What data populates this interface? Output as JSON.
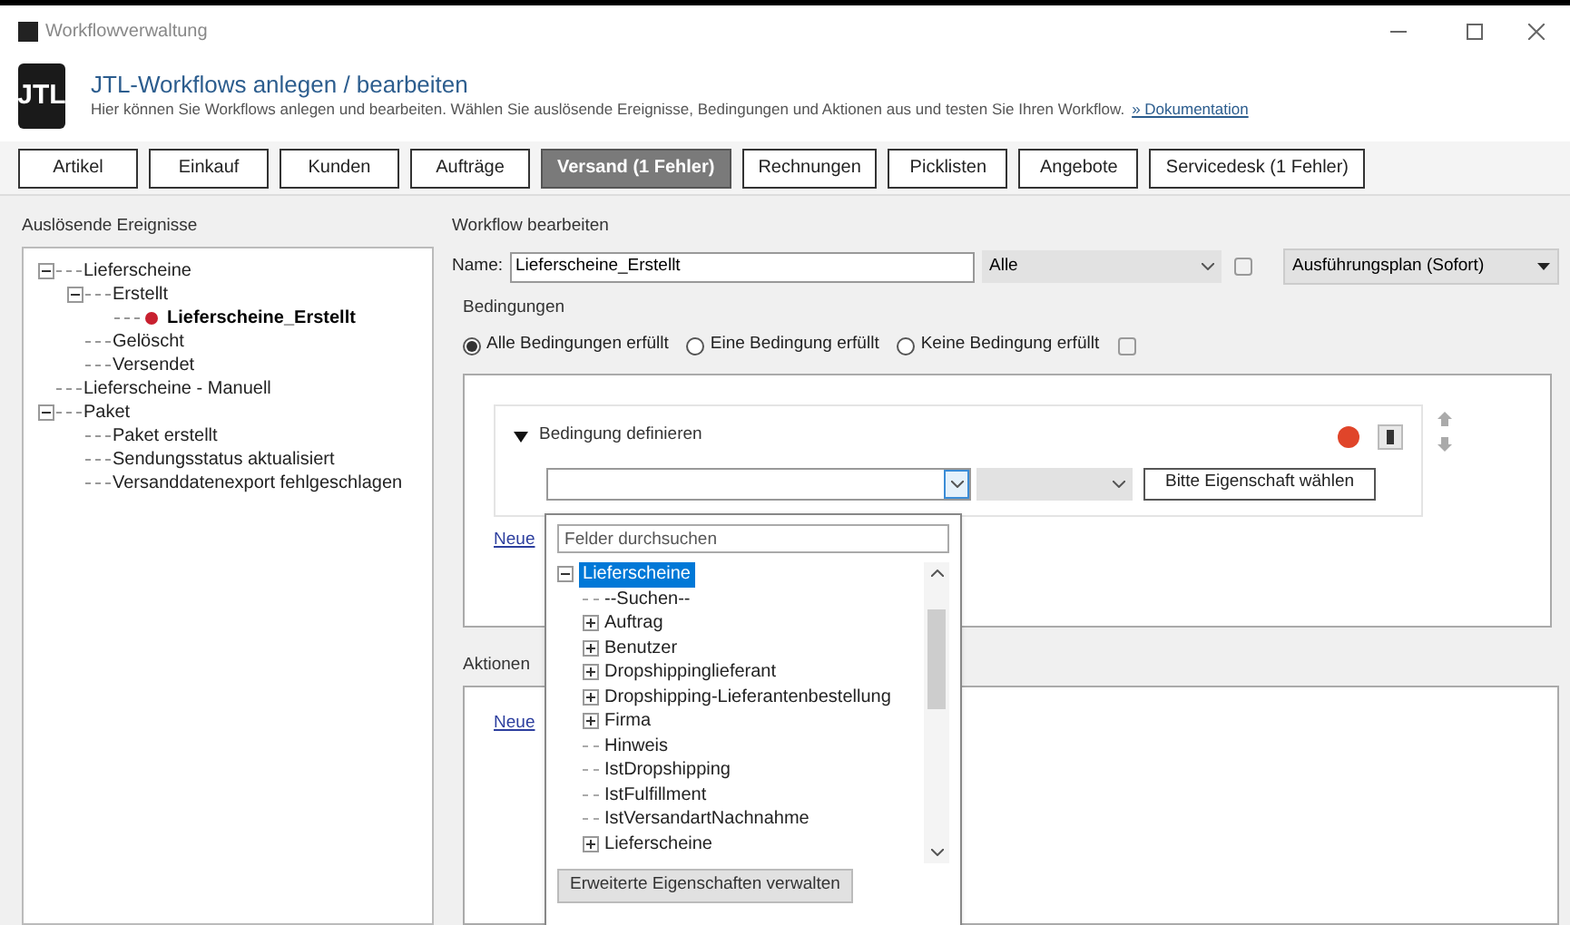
{
  "window": {
    "title": "Workflowverwaltung"
  },
  "header": {
    "logo": "JTL",
    "title": "JTL-Workflows anlegen / bearbeiten",
    "subtitle": "Hier können Sie Workflows anlegen und bearbeiten. Wählen Sie auslösende Ereignisse, Bedingungen und Aktionen aus und testen Sie Ihren Workflow.",
    "link": "» Dokumentation"
  },
  "tabs": [
    {
      "label": "Artikel",
      "selected": false
    },
    {
      "label": "Einkauf",
      "selected": false
    },
    {
      "label": "Kunden",
      "selected": false
    },
    {
      "label": "Aufträge",
      "selected": false
    },
    {
      "label": "Versand (1 Fehler)",
      "selected": true
    },
    {
      "label": "Rechnungen",
      "selected": false
    },
    {
      "label": "Picklisten",
      "selected": false
    },
    {
      "label": "Angebote",
      "selected": false
    },
    {
      "label": "Servicedesk (1 Fehler)",
      "selected": false
    }
  ],
  "events": {
    "title": "Auslösende Ereignisse",
    "tree": [
      {
        "label": "Lieferscheine",
        "kind": "event",
        "expanded": true,
        "children": [
          {
            "label": "Erstellt",
            "kind": "event",
            "expanded": true,
            "children": [
              {
                "label": "Lieferscheine_Erstellt",
                "kind": "workflow"
              }
            ]
          },
          {
            "label": "Gelöscht",
            "kind": "event"
          },
          {
            "label": "Versendet",
            "kind": "event"
          }
        ]
      },
      {
        "label": "Lieferscheine - Manuell",
        "kind": "event"
      },
      {
        "label": "Paket",
        "kind": "event",
        "expanded": true,
        "children": [
          {
            "label": "Paket erstellt",
            "kind": "event"
          },
          {
            "label": "Sendungsstatus aktualisiert",
            "kind": "event"
          },
          {
            "label": "Versanddatenexport fehlgeschlagen",
            "kind": "event"
          }
        ]
      }
    ]
  },
  "editor": {
    "title": "Workflow bearbeiten",
    "name_label": "Name:",
    "name_value": "Lieferscheine_Erstellt",
    "scope": "Alle",
    "schedule": "Ausführungsplan (Sofort)",
    "conditions": {
      "title": "Bedingungen",
      "modes": [
        {
          "label": "Alle Bedingungen erfüllt",
          "selected": true
        },
        {
          "label": "Eine Bedingung erfüllt",
          "selected": false
        },
        {
          "label": "Keine Bedingung erfüllt",
          "selected": false
        }
      ],
      "condition": {
        "title": "Bedingung definieren",
        "expanded": true,
        "error": true,
        "property_button": "Bitte Eigenschaft wählen"
      },
      "new_link": "Neue"
    },
    "actions": {
      "title": "Aktionen",
      "new_link": "Neue"
    }
  },
  "field_dropdown": {
    "search_placeholder": "Felder durchsuchen",
    "tree": [
      {
        "label": "Lieferscheine",
        "selected": true,
        "expanded": true,
        "children": [
          {
            "label": "--Suchen--",
            "selected": false
          },
          {
            "label": "Auftrag",
            "selected": false,
            "expanded": false
          },
          {
            "label": "Benutzer",
            "selected": false,
            "expanded": false
          },
          {
            "label": "Dropshippinglieferant",
            "selected": false,
            "expanded": false
          },
          {
            "label": "Dropshipping-Lieferantenbestellung",
            "selected": false,
            "expanded": false
          },
          {
            "label": "Firma",
            "selected": false,
            "expanded": false
          },
          {
            "label": "Hinweis",
            "selected": false
          },
          {
            "label": "IstDropshipping",
            "selected": false
          },
          {
            "label": "IstFulfillment",
            "selected": false
          },
          {
            "label": "IstVersandartNachnahme",
            "selected": false
          },
          {
            "label": "Lieferscheine",
            "selected": false,
            "expanded": false
          }
        ]
      }
    ],
    "button": "Erweiterte Eigenschaften verwalten"
  }
}
